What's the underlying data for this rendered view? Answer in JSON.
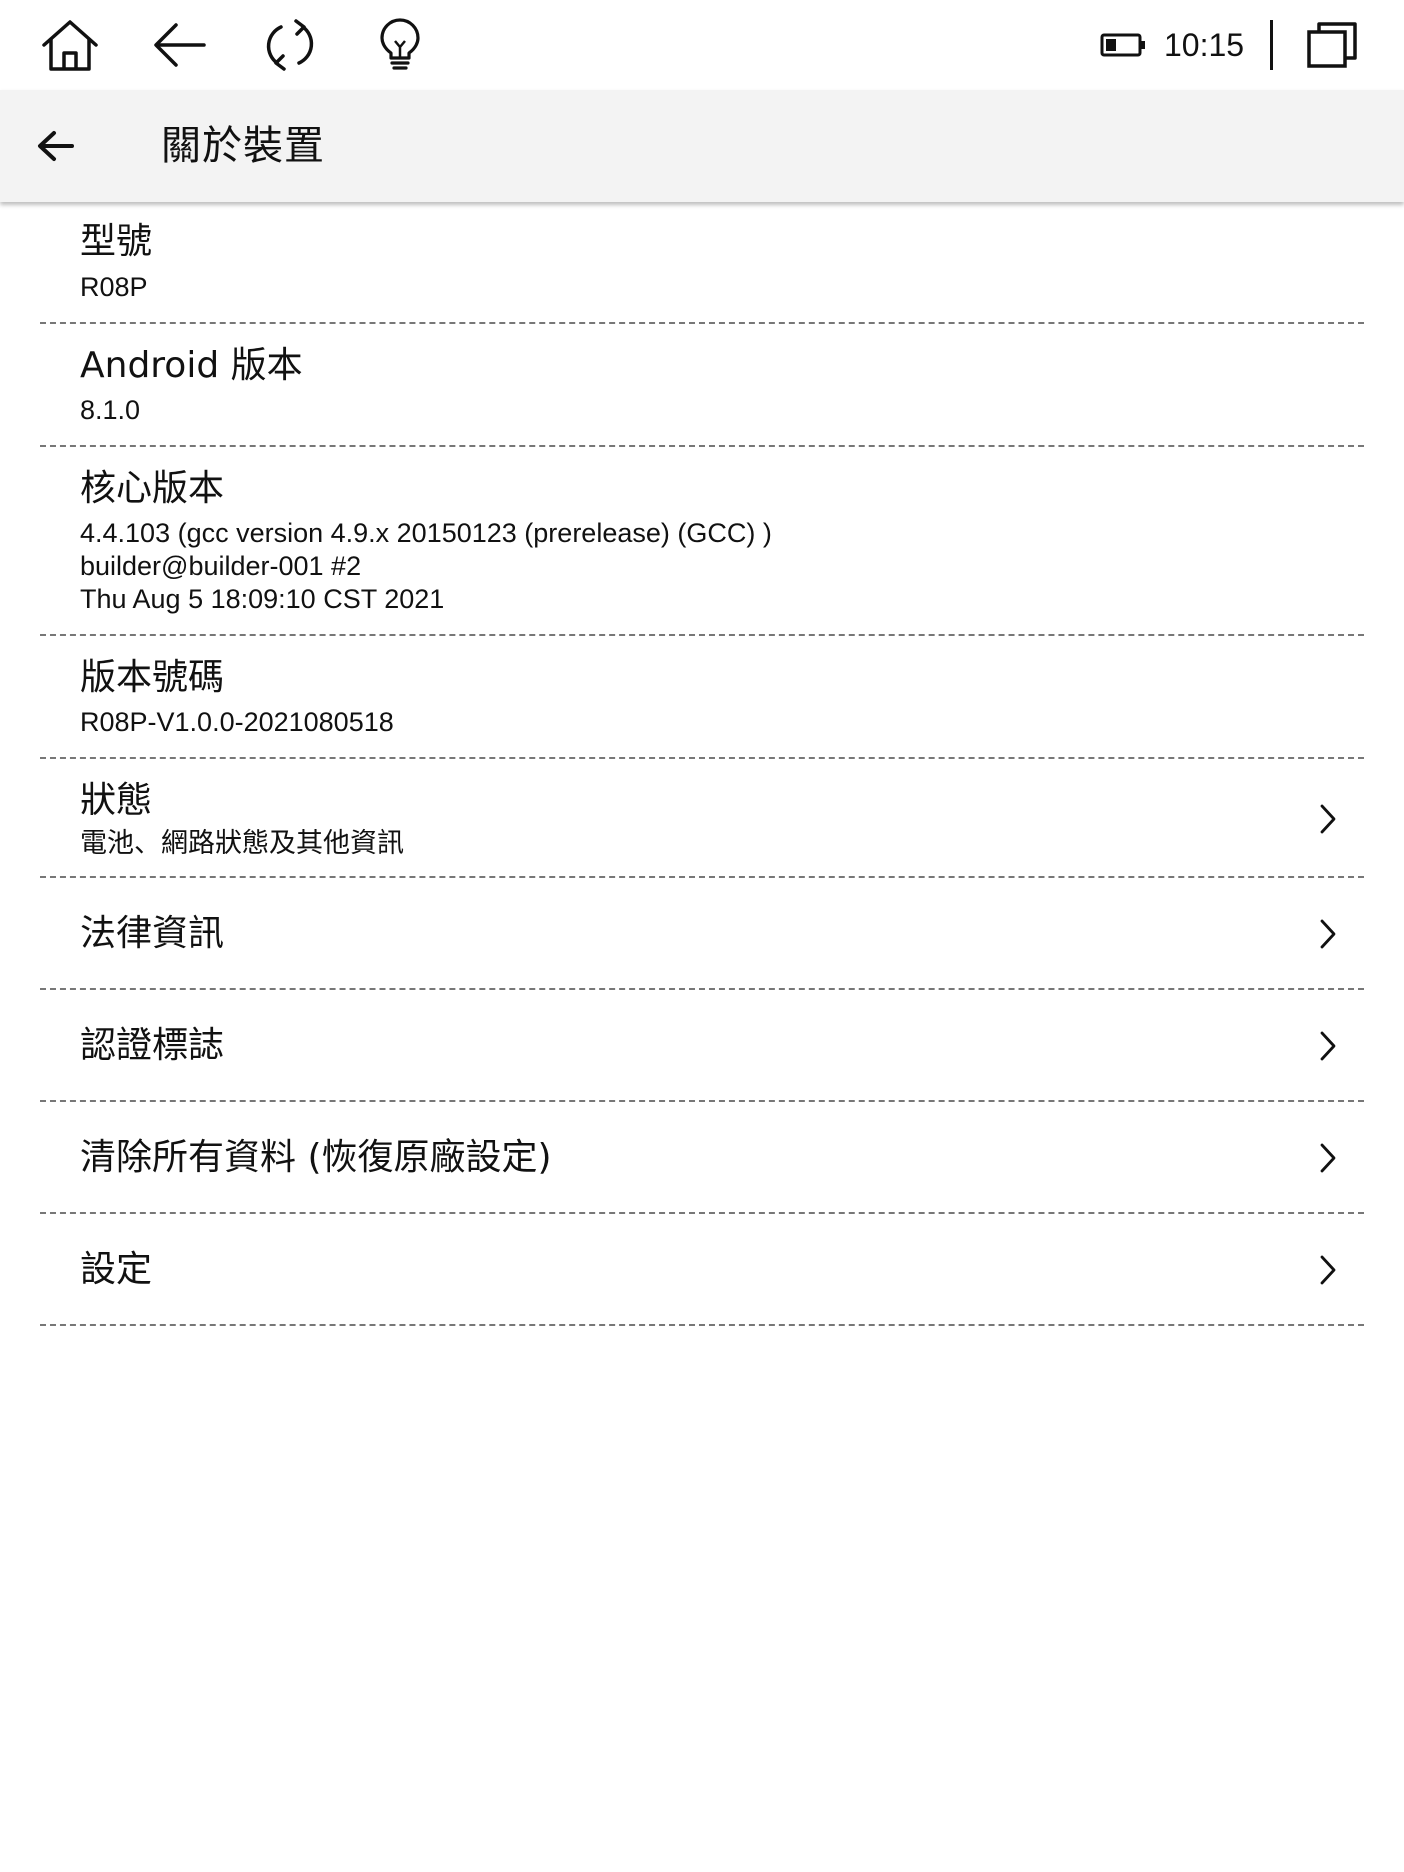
{
  "status_bar": {
    "icons": [
      "home-icon",
      "back-arrow-icon",
      "refresh-icon",
      "lightbulb-icon"
    ],
    "battery_icon": "battery-icon",
    "time": "10:15",
    "window_icon": "multi-window-icon"
  },
  "header": {
    "back_icon": "arrow-left-icon",
    "title": "關於裝置"
  },
  "items": [
    {
      "title": "型號",
      "subtitle": "R08P"
    },
    {
      "title": "Android 版本",
      "subtitle": "8.1.0"
    },
    {
      "title": "核心版本",
      "subtitle_lines": [
        "4.4.103 (gcc version 4.9.x 20150123 (prerelease) (GCC) )",
        "builder@builder-001 #2",
        "Thu Aug 5 18:09:10 CST 2021"
      ]
    },
    {
      "title": "版本號碼",
      "subtitle": "R08P-V1.0.0-2021080518"
    },
    {
      "title": "狀態",
      "subtitle": "電池、網路狀態及其他資訊"
    },
    {
      "title": "法律資訊"
    },
    {
      "title": "認證標誌"
    },
    {
      "title": "清除所有資料 (恢復原廠設定)"
    },
    {
      "title": "設定"
    }
  ],
  "colors": {
    "header_bg": "#f3f3f3",
    "divider": "#777777",
    "text": "#111111"
  }
}
